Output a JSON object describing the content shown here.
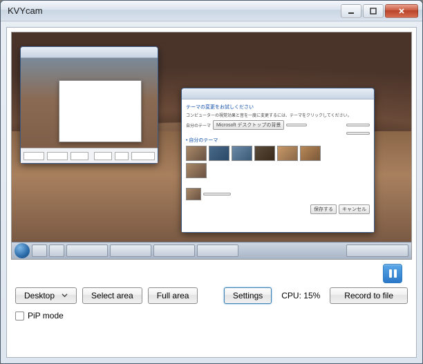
{
  "window": {
    "title": "KVYcam"
  },
  "controls": {
    "source_label": "Desktop",
    "select_area_label": "Select area",
    "full_area_label": "Full area",
    "settings_label": "Settings",
    "cpu_text": "CPU: 15%",
    "record_label": "Record to file",
    "pip_label": "PiP mode",
    "pip_checked": false
  },
  "preview": {
    "dialog_header": "テーマの変更をお試しください",
    "dialog_sub": "コンピューターの視覚効果と音を一度に変更するには、テーマをクリックしてください。",
    "section_label": "自分のテーマ",
    "combo_hint": "Microsoft デスクトップの背景",
    "thumb_count": 6,
    "ok": "保存する",
    "cancel": "キャンセル"
  }
}
